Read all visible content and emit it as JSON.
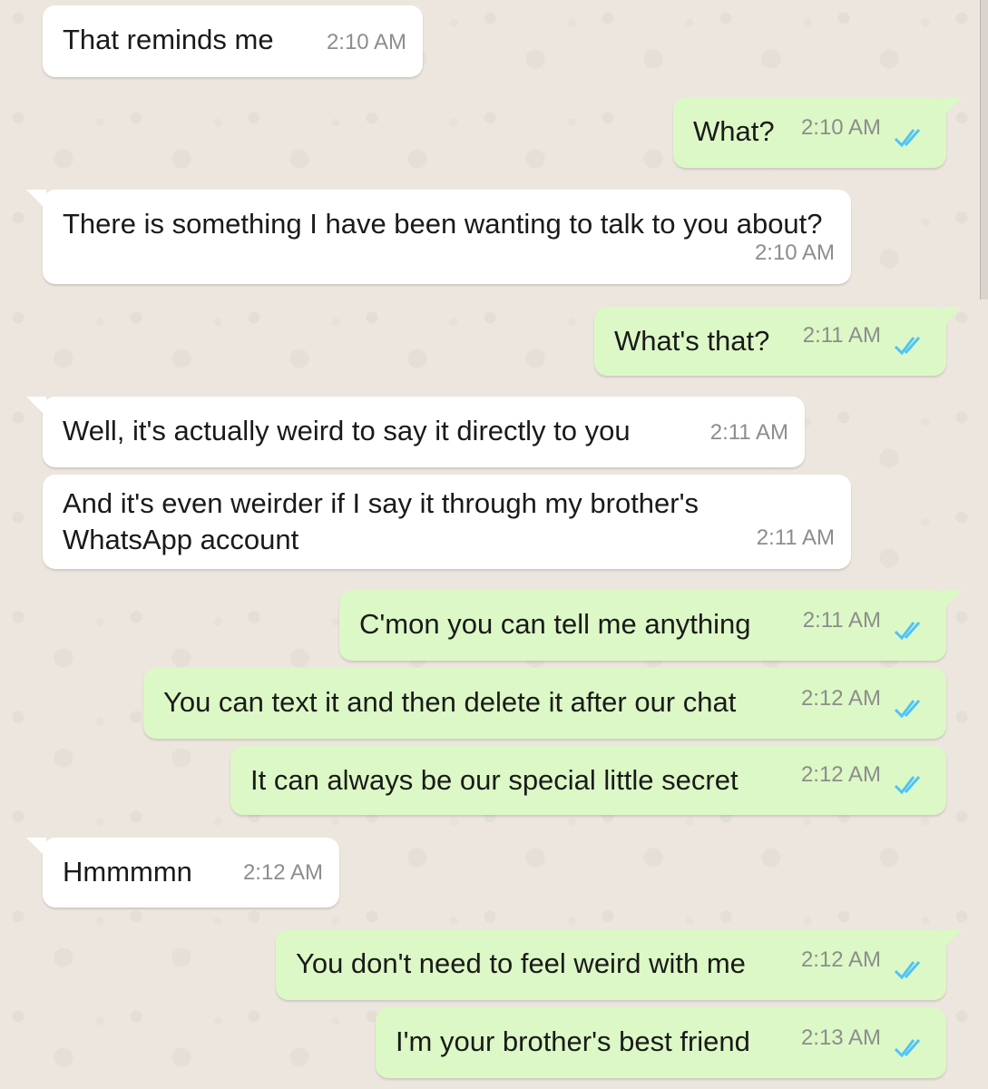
{
  "messages": [
    {
      "direction": "in",
      "text": "That reminds me",
      "time": "2:10 AM",
      "tick": "double-check-icon"
    },
    {
      "direction": "out",
      "text": "What?",
      "time": "2:10 AM",
      "tick": "double-check-icon"
    },
    {
      "direction": "in",
      "text": "There is something I have been wanting to talk to you about?",
      "time": "2:10 AM"
    },
    {
      "direction": "out",
      "text": "What's that?",
      "time": "2:11 AM",
      "tick": "double-check-icon"
    },
    {
      "direction": "in",
      "text": "Well, it's actually weird to say it directly to you",
      "time": "2:11 AM"
    },
    {
      "direction": "in",
      "text": "And it's even weirder if I say it through my brother's WhatsApp account",
      "time": "2:11 AM"
    },
    {
      "direction": "out",
      "text": "C'mon you can tell me anything",
      "time": "2:11 AM",
      "tick": "double-check-icon"
    },
    {
      "direction": "out",
      "text": "You can text it and then delete it after our chat",
      "time": "2:12 AM",
      "tick": "double-check-icon"
    },
    {
      "direction": "out",
      "text": "It can always be our special little secret",
      "time": "2:12 AM",
      "tick": "double-check-icon"
    },
    {
      "direction": "in",
      "text": "Hmmmmn",
      "time": "2:12 AM"
    },
    {
      "direction": "out",
      "text": "You don't need to feel weird with me",
      "time": "2:12 AM",
      "tick": "double-check-icon"
    },
    {
      "direction": "out",
      "text": "I'm your brother's best friend",
      "time": "2:13 AM",
      "tick": "double-check-icon"
    }
  ],
  "colors": {
    "incoming_bubble": "#ffffff",
    "outgoing_bubble": "#dcf8c6",
    "read_tick": "#4fc3f7",
    "timestamp": "#8d8d8d"
  }
}
